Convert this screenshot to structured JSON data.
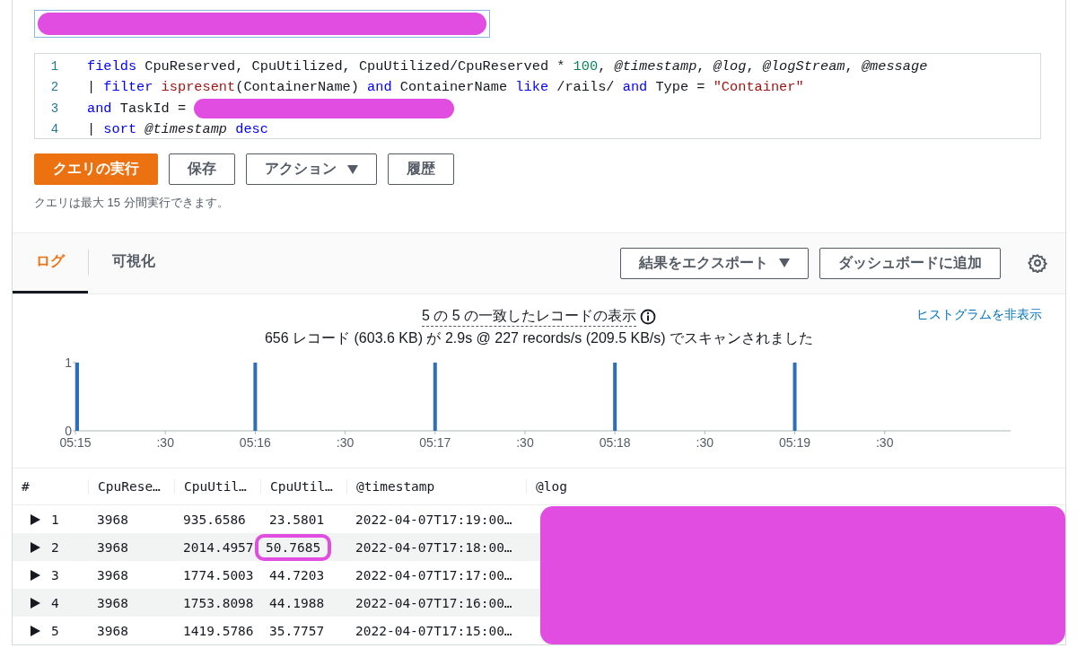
{
  "query_name": {
    "redacted": true
  },
  "editor": {
    "lines": [
      {
        "number": "1",
        "tokens": [
          {
            "kind": "kw",
            "text": "fields"
          },
          {
            "kind": "plain",
            "text": " CpuReserved, CpuUtilized, CpuUtilized/CpuReserved * "
          },
          {
            "kind": "num",
            "text": "100"
          },
          {
            "kind": "plain",
            "text": ", "
          },
          {
            "kind": "var",
            "text": "@timestamp"
          },
          {
            "kind": "plain",
            "text": ", "
          },
          {
            "kind": "var",
            "text": "@log"
          },
          {
            "kind": "plain",
            "text": ", "
          },
          {
            "kind": "var",
            "text": "@logStream"
          },
          {
            "kind": "plain",
            "text": ", "
          },
          {
            "kind": "var",
            "text": "@message"
          }
        ]
      },
      {
        "number": "2",
        "tokens": [
          {
            "kind": "plain",
            "text": "| "
          },
          {
            "kind": "kw",
            "text": "filter"
          },
          {
            "kind": "fn",
            "text": " ispresent"
          },
          {
            "kind": "plain",
            "text": "(ContainerName) "
          },
          {
            "kind": "kw",
            "text": "and"
          },
          {
            "kind": "plain",
            "text": " ContainerName "
          },
          {
            "kind": "kw",
            "text": "like"
          },
          {
            "kind": "plain",
            "text": " /rails/ "
          },
          {
            "kind": "kw",
            "text": "and"
          },
          {
            "kind": "plain",
            "text": " Type = "
          },
          {
            "kind": "str",
            "text": "\"Container\""
          }
        ]
      },
      {
        "number": "3",
        "tokens": [
          {
            "kind": "kw",
            "text": "and"
          },
          {
            "kind": "plain",
            "text": " TaskId = "
          },
          {
            "kind": "redaction"
          }
        ]
      },
      {
        "number": "4",
        "tokens": [
          {
            "kind": "plain",
            "text": "| "
          },
          {
            "kind": "kw",
            "text": "sort"
          },
          {
            "kind": "var",
            "text": " @timestamp "
          },
          {
            "kind": "kw",
            "text": "desc"
          }
        ]
      }
    ]
  },
  "actions": [
    {
      "label": "クエリの実行",
      "kind": "primary"
    },
    {
      "label": "保存",
      "kind": "normal"
    },
    {
      "label": "アクション",
      "kind": "dropdown"
    },
    {
      "label": "履歴",
      "kind": "normal"
    }
  ],
  "query_note": "クエリは最大 15 分間実行できます。",
  "tabs": [
    {
      "label": "ログ",
      "selected": true
    },
    {
      "label": "可視化",
      "selected": false
    }
  ],
  "tab_buttons": [
    {
      "label": "結果をエクスポート",
      "kind": "dropdown"
    },
    {
      "label": "ダッシュボードに追加",
      "kind": "normal"
    }
  ],
  "summary": "5 の 5 の一致したレコードの表示",
  "scan_info": "656 レコード (603.6 KB) が 2.9s @ 227 records/s (209.5 KB/s) でスキャンされました",
  "hide_histogram": "ヒストグラムを非表示",
  "histogram": {
    "chart_data": {
      "type": "bar",
      "categories": [
        "05:15",
        ":30",
        "05:16",
        ":30",
        "05:17",
        ":30",
        "05:18",
        ":30",
        "05:19",
        ":30"
      ],
      "series": [
        {
          "color": "#2f6fb7",
          "values": [
            1,
            null,
            1,
            null,
            1,
            null,
            1,
            null,
            1,
            null
          ]
        }
      ],
      "ylim": [
        0,
        1
      ],
      "yticks": [
        0,
        1
      ]
    }
  },
  "table": {
    "columns": [
      "#",
      "CpuRese…",
      "CpuUtil…",
      "CpuUtil…",
      "@timestamp",
      "@log"
    ],
    "rows": [
      {
        "cells": [
          "1",
          "3968",
          "935.6586",
          "23.5801",
          "2022-04-07T17:19:00…"
        ],
        "highlighted": false
      },
      {
        "cells": [
          "2",
          "3968",
          "2014.4957",
          "50.7685",
          "2022-04-07T17:18:00…"
        ],
        "highlighted": true
      },
      {
        "cells": [
          "3",
          "3968",
          "1774.5003",
          "44.7203",
          "2022-04-07T17:17:00…"
        ],
        "highlighted": false
      },
      {
        "cells": [
          "4",
          "3968",
          "1753.8098",
          "44.1988",
          "2022-04-07T17:16:00…"
        ],
        "highlighted": false
      },
      {
        "cells": [
          "5",
          "3968",
          "1419.5786",
          "35.7757",
          "2022-04-07T17:15:00…"
        ],
        "highlighted": false
      }
    ],
    "log_redacted": true
  }
}
